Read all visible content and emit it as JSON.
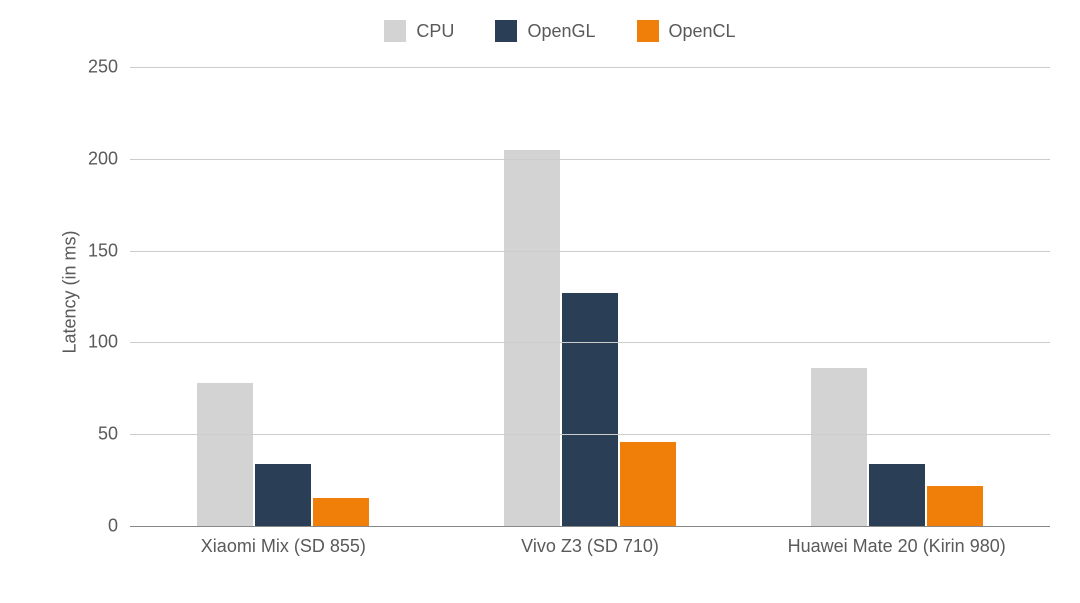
{
  "chart_data": {
    "type": "bar",
    "title": "",
    "xlabel": "",
    "ylabel": "Latency (in ms)",
    "ylim": [
      0,
      250
    ],
    "ytick_step": 50,
    "categories": [
      "Xiaomi Mix (SD 855)",
      "Vivo Z3 (SD 710)",
      "Huawei Mate 20 (Kirin 980)"
    ],
    "series": [
      {
        "name": "CPU",
        "color": "#d3d3d3",
        "values": [
          78,
          205,
          86
        ]
      },
      {
        "name": "OpenGL",
        "color": "#2a3e56",
        "values": [
          34,
          127,
          34
        ]
      },
      {
        "name": "OpenCL",
        "color": "#f07f0a",
        "values": [
          15,
          46,
          22
        ]
      }
    ],
    "legend_position": "top",
    "grid": true
  }
}
